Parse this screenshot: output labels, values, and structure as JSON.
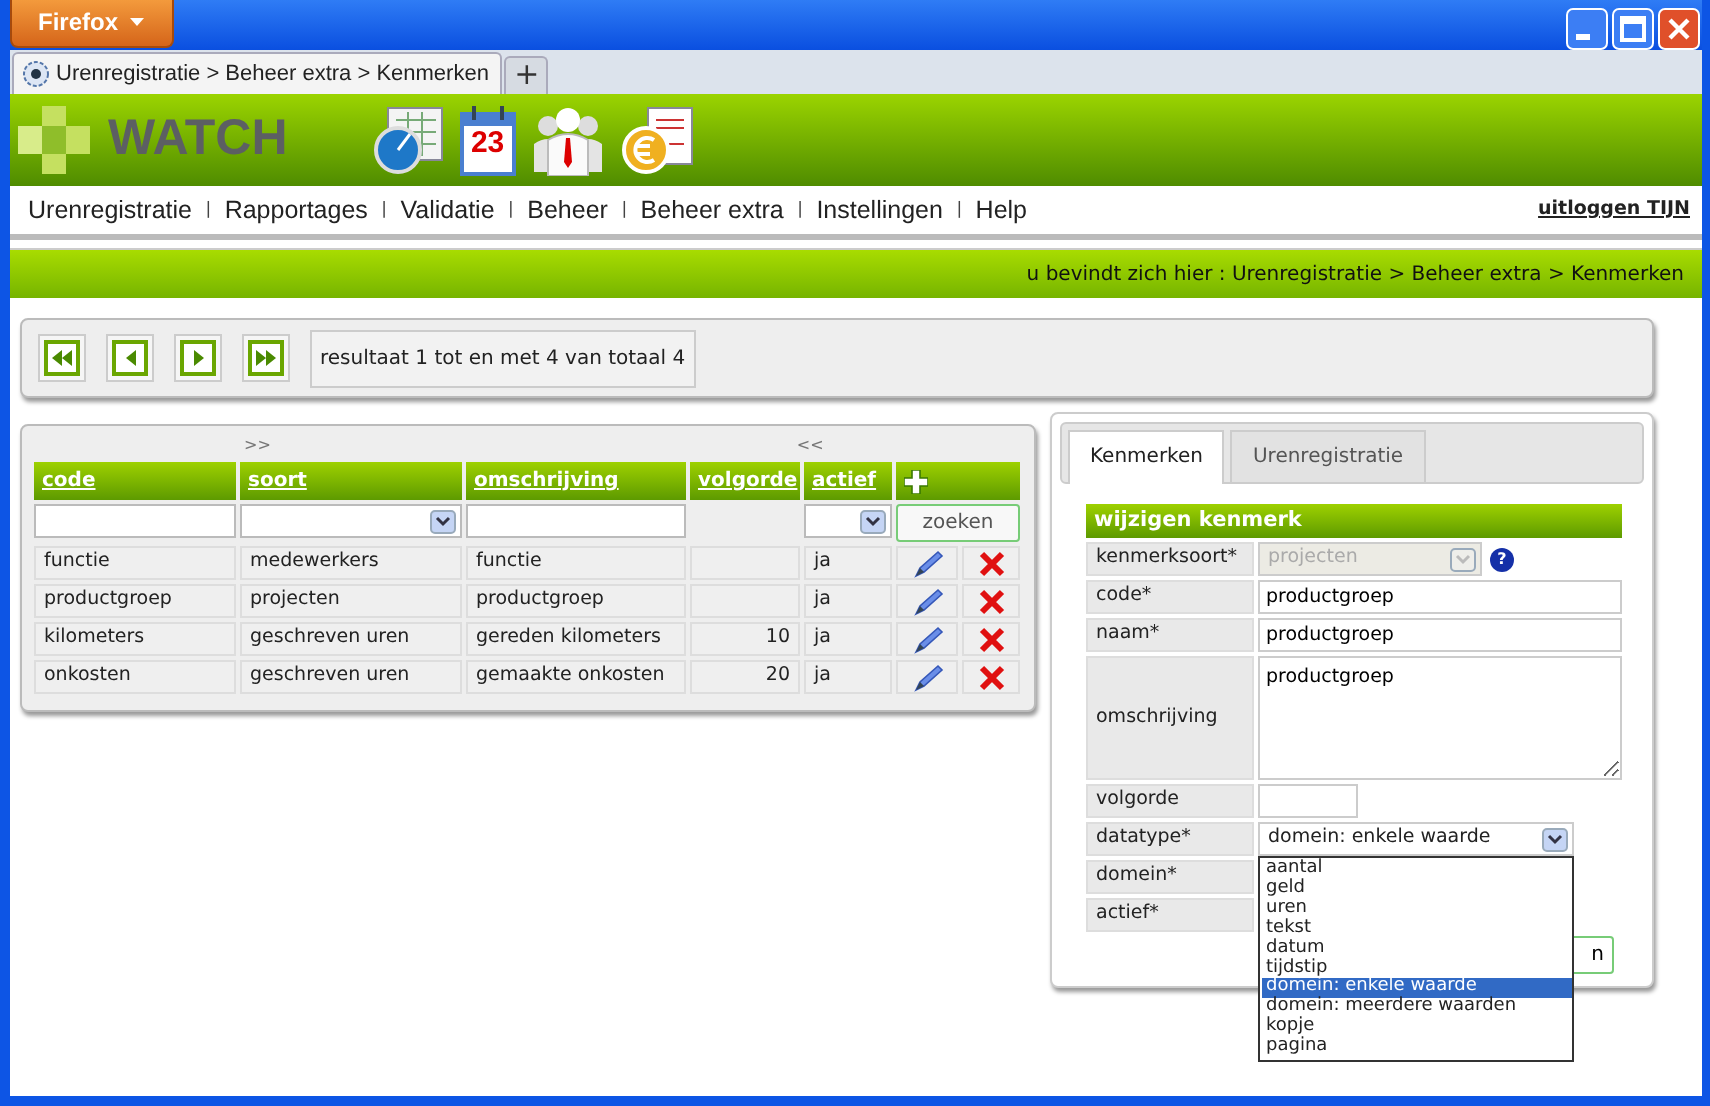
{
  "browser": {
    "menu_button": "Firefox",
    "tab_title": "Urenregistratie > Beheer extra > Kenmerken",
    "new_tab": "+"
  },
  "app": {
    "logo": "WATCH",
    "calendar_day": "23"
  },
  "menu": {
    "items": [
      "Urenregistratie",
      "Rapportages",
      "Validatie",
      "Beheer",
      "Beheer extra",
      "Instellingen",
      "Help"
    ],
    "separators": [
      "|",
      "|",
      "|",
      "|",
      "|",
      "|"
    ],
    "logout": "uitloggen TIJN"
  },
  "breadcrumb": "u bevindt zich hier : Urenregistratie > Beheer extra > Kenmerken",
  "pager": {
    "status": "resultaat 1 tot en met 4 van totaal 4"
  },
  "table": {
    "shift_right": ">>",
    "shift_left": "<<",
    "columns": [
      "code",
      "soort",
      "omschrijving",
      "volgorde",
      "actief"
    ],
    "filter_button": "zoeken",
    "rows": [
      {
        "code": "functie",
        "soort": "medewerkers",
        "omschrijving": "functie",
        "actief": "ja"
      },
      {
        "code": "productgroep",
        "soort": "projecten",
        "omschrijving": "productgroep",
        "actief": "ja"
      },
      {
        "code": "kilometers",
        "soort": "geschreven uren",
        "omschrijving": "gereden kilometers",
        "volgorde": "10",
        "actief": "ja"
      },
      {
        "code": "onkosten",
        "soort": "geschreven uren",
        "omschrijving": "gemaakte onkosten",
        "volgorde": "20",
        "actief": "ja"
      }
    ]
  },
  "detail": {
    "tabs": [
      {
        "label": "Kenmerken",
        "selected": true
      },
      {
        "label": "Urenregistratie",
        "selected": false
      }
    ],
    "form_title": "wijzigen kenmerk",
    "fields": [
      {
        "kind": "select",
        "label": "kenmerksoort*",
        "value": "projecten",
        "disabled": true,
        "help_icon": "?"
      },
      {
        "kind": "text",
        "label": "code*",
        "value": "productgroep"
      },
      {
        "kind": "text",
        "label": "naam*",
        "value": "productgroep"
      },
      {
        "kind": "textarea",
        "label": "omschrijving",
        "value": "productgroep"
      },
      {
        "kind": "short",
        "label": "volgorde"
      },
      {
        "kind": "select",
        "label": "datatype*",
        "value": "domein: enkele waarde",
        "disabled": false,
        "expanded": true,
        "options": [
          {
            "label": "aantal",
            "selected": false
          },
          {
            "label": "geld",
            "selected": false
          },
          {
            "label": "uren",
            "selected": false
          },
          {
            "label": "tekst",
            "selected": false
          },
          {
            "label": "datum",
            "selected": false
          },
          {
            "label": "tijdstip",
            "selected": false
          },
          {
            "label": "domein: enkele waarde",
            "selected": true
          },
          {
            "label": "domein: meerdere waarden",
            "selected": false
          },
          {
            "label": "kopje",
            "selected": false
          },
          {
            "label": "pagina",
            "selected": false
          }
        ]
      },
      {
        "kind": "covered",
        "label": "domein*"
      },
      {
        "kind": "covered",
        "label": "actief*"
      }
    ],
    "submit": "n"
  }
}
